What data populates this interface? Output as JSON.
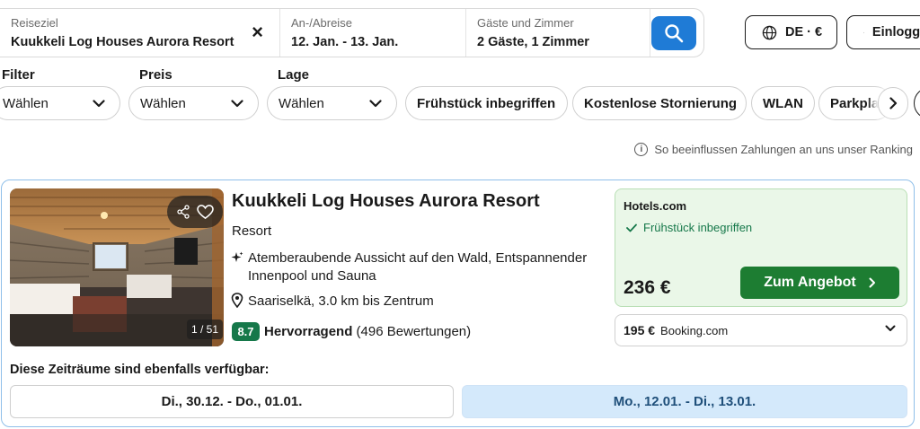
{
  "search": {
    "destination_label": "Reiseziel",
    "destination_value": "Kuukkeli Log Houses Aurora Resort",
    "clear_icon": "close-icon",
    "dates_label": "An-/Abreise",
    "dates_value": "12. Jan. - 13. Jan.",
    "guests_label": "Gäste und Zimmer",
    "guests_value": "2 Gäste, 1 Zimmer",
    "search_icon": "search-icon",
    "accent_color": "#1f7bd6"
  },
  "header": {
    "locale_label": "DE · €",
    "login_label": "Einloggen"
  },
  "filters": {
    "groups": [
      {
        "label": "Filter",
        "value": "Wählen"
      },
      {
        "label": "Preis",
        "value": "Wählen"
      },
      {
        "label": "Lage",
        "value": "Wählen"
      }
    ],
    "chips": [
      "Frühstück inbegriffen",
      "Kostenlose Stornierung",
      "WLAN",
      "Parkplatz"
    ]
  },
  "ranking_note": "So beeinflussen Zahlungen an uns unser Ranking",
  "hotel": {
    "name": "Kuukkeli Log Houses Aurora Resort",
    "type": "Resort",
    "highlight": "Atemberaubende Aussicht auf den Wald, Entspannender Innenpool und Sauna",
    "location": "Saariselkä, 3.0 km bis Zentrum",
    "score": "8.7",
    "rating_word": "Hervorragend",
    "reviews": "(496 Bewertungen)",
    "photo_counter": "1 / 51",
    "score_color": "#16784a"
  },
  "deal": {
    "provider": "Hotels.com",
    "perk": "Frühstück inbegriffen",
    "price": "236 €",
    "cta_label": "Zum Angebot",
    "cta_color": "#1d7d32"
  },
  "alt_offer": {
    "price": "195 €",
    "provider": "Booking.com"
  },
  "availability": {
    "title": "Diese Zeiträume sind ebenfalls verfügbar:",
    "options": [
      "Di., 30.12. - Do., 01.01.",
      "Mo., 12.01. - Di., 13.01."
    ]
  }
}
